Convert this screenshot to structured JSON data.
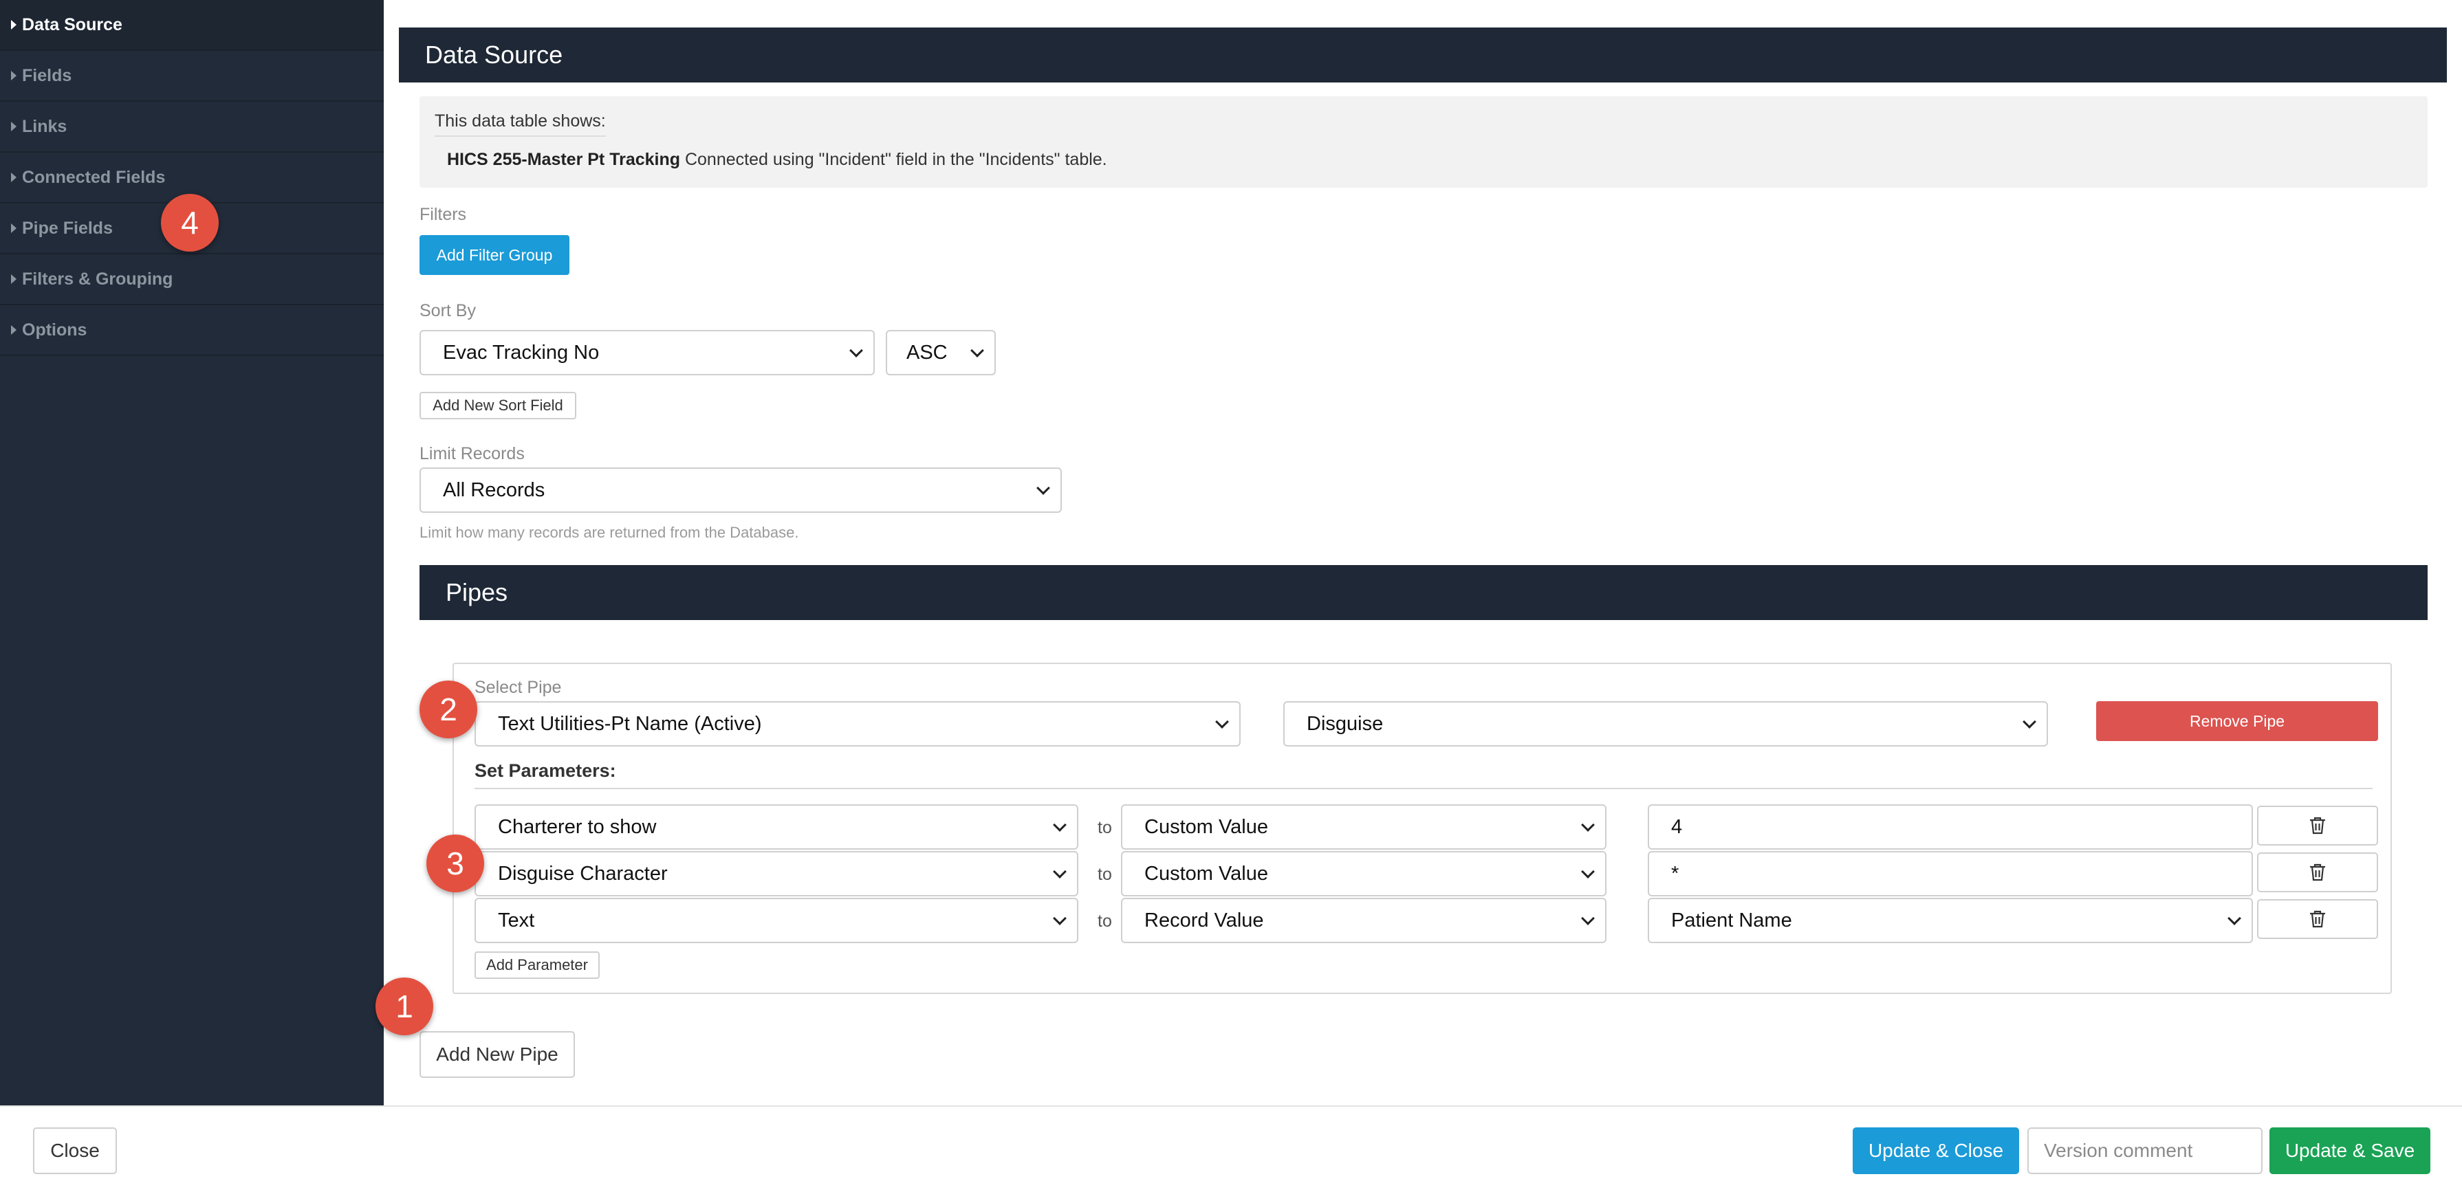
{
  "sidebar": {
    "items": [
      {
        "label": "Data Source"
      },
      {
        "label": "Fields"
      },
      {
        "label": "Links"
      },
      {
        "label": "Connected Fields"
      },
      {
        "label": "Pipe Fields"
      },
      {
        "label": "Filters & Grouping"
      },
      {
        "label": "Options"
      }
    ]
  },
  "data_source": {
    "header": "Data Source",
    "info_label": "This data table shows:",
    "info_bold": "HICS 255-Master Pt Tracking",
    "info_rest": " Connected using \"Incident\" field in the \"Incidents\" table."
  },
  "filters": {
    "label": "Filters",
    "add_button": "Add Filter Group"
  },
  "sort": {
    "label": "Sort By",
    "field": "Evac Tracking No",
    "order": "ASC",
    "add_button": "Add New Sort Field"
  },
  "limit": {
    "label": "Limit Records",
    "value": "All Records",
    "help": "Limit how many records are returned from the Database."
  },
  "pipes": {
    "header": "Pipes",
    "select_label": "Select Pipe",
    "pipe_value": "Text Utilities-Pt Name (Active)",
    "action_value": "Disguise",
    "remove_button": "Remove Pipe",
    "params_label": "Set Parameters:",
    "to_text": "to",
    "params": [
      {
        "name": "Charterer to show",
        "source": "Custom Value",
        "value": "4"
      },
      {
        "name": "Disguise Character",
        "source": "Custom Value",
        "value": "*"
      },
      {
        "name": "Text",
        "source": "Record Value",
        "value": "Patient Name"
      }
    ],
    "add_param_button": "Add Parameter",
    "add_pipe_button": "Add New Pipe"
  },
  "badges": {
    "b1": "1",
    "b2": "2",
    "b3": "3",
    "b4": "4"
  },
  "footer": {
    "close": "Close",
    "update_close": "Update & Close",
    "version_placeholder": "Version comment",
    "update_save": "Update & Save"
  },
  "colors": {
    "sidebar_bg": "#222b39",
    "header_bg": "#1f2836",
    "primary": "#1b9bd7",
    "danger": "#dc5350",
    "success": "#1aa355",
    "badge": "#e4503f"
  }
}
